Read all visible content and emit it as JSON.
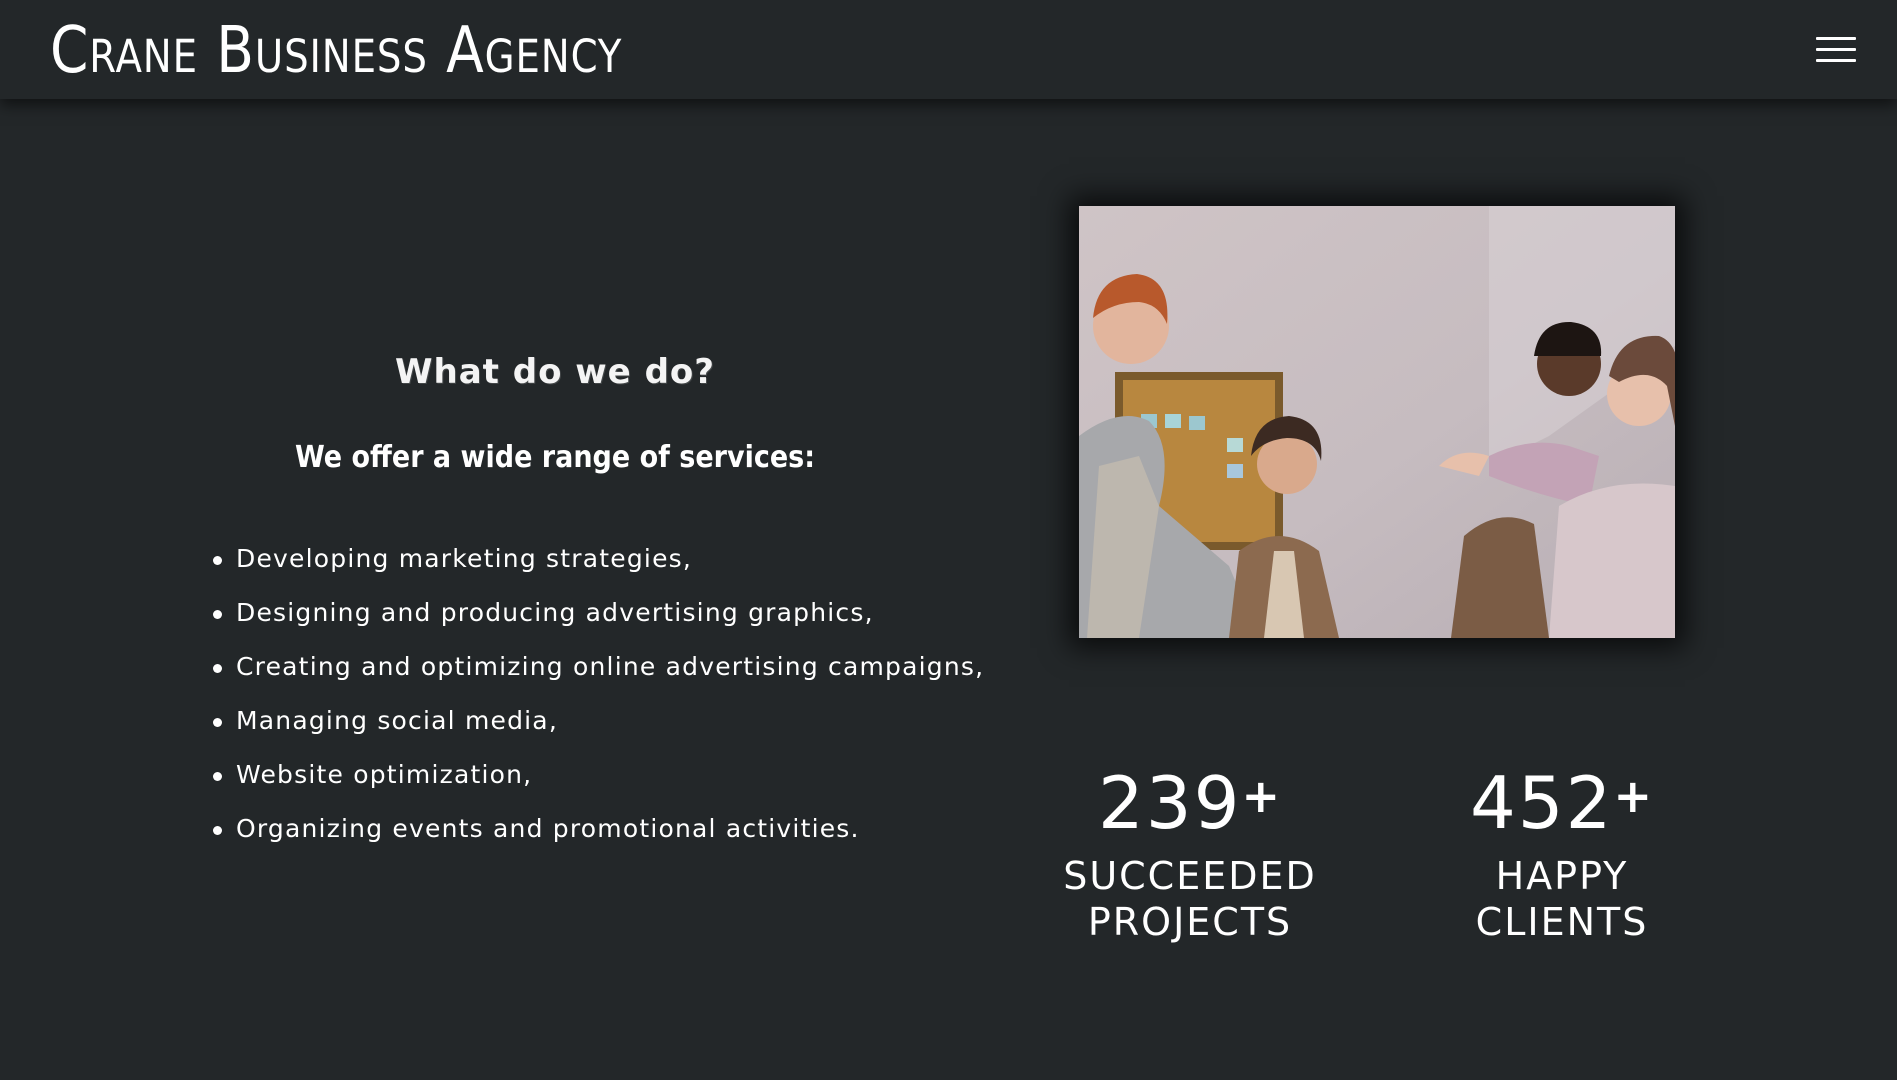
{
  "header": {
    "brand": "Crane Business Agency",
    "menu_icon": "hamburger-menu-icon"
  },
  "services": {
    "title": "What do we do?",
    "subtitle": "We offer a wide range of services:",
    "items": [
      "Developing marketing strategies,",
      "Designing and producing advertising graphics,",
      "Creating and optimizing online advertising campaigns,",
      "Managing social media,",
      "Website optimization,",
      "Organizing events and promotional activities."
    ]
  },
  "stats": [
    {
      "number": "239",
      "suffix": "+",
      "label_line1": "Succeeded",
      "label_line2": "Projects"
    },
    {
      "number": "452",
      "suffix": "+",
      "label_line1": "Happy",
      "label_line2": "Clients"
    }
  ]
}
